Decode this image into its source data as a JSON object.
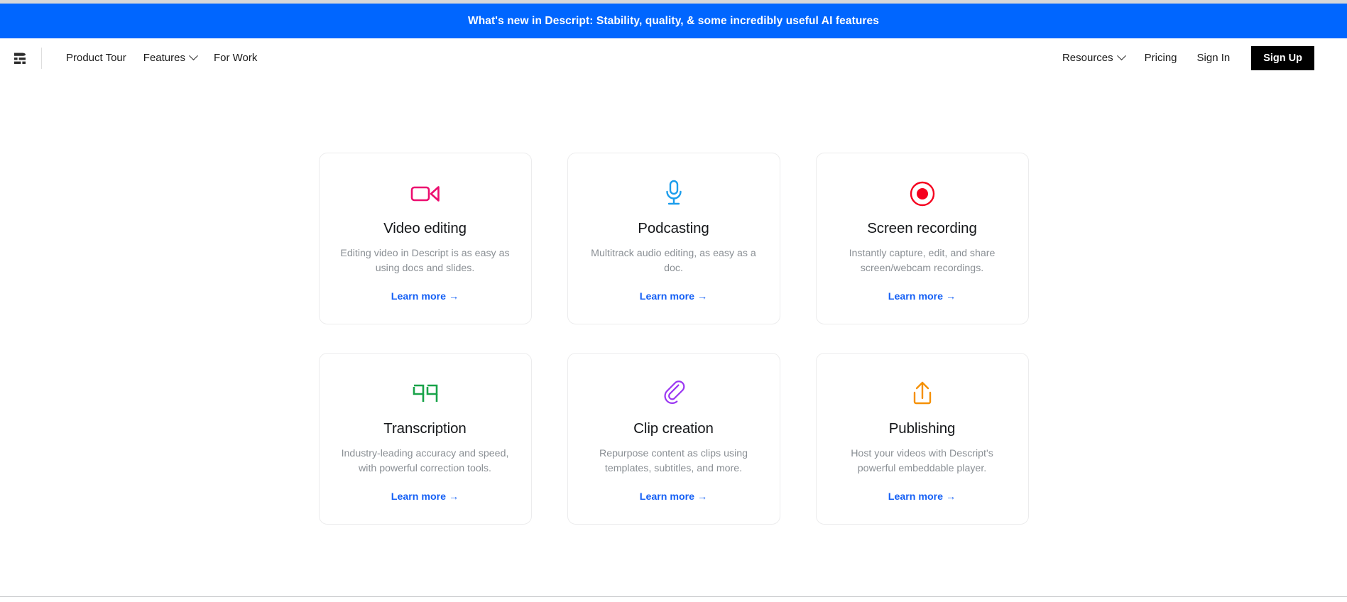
{
  "banner": {
    "text": "What's new in Descript: Stability, quality, & some incredibly useful AI features",
    "background_color": "#0066ff",
    "text_color": "#ffffff"
  },
  "nav": {
    "logo_name": "descript-logo",
    "left_links": [
      {
        "label": "Product Tour",
        "has_chevron": false
      },
      {
        "label": "Features",
        "has_chevron": true
      },
      {
        "label": "For Work",
        "has_chevron": false
      }
    ],
    "right_links": [
      {
        "label": "Resources",
        "has_chevron": true
      },
      {
        "label": "Pricing",
        "has_chevron": false
      },
      {
        "label": "Sign In",
        "has_chevron": false
      }
    ],
    "signup_label": "Sign Up",
    "signup_bg": "#000000"
  },
  "cards": [
    {
      "icon": "video-camera-icon",
      "icon_color": "#ec0d6f",
      "title": "Video editing",
      "description": "Editing video in Descript is as easy as using docs and slides.",
      "link_label": "Learn more →"
    },
    {
      "icon": "microphone-icon",
      "icon_color": "#1b9dec",
      "title": "Podcasting",
      "description": "Multitrack audio editing, as easy as a doc.",
      "link_label": "Learn more →"
    },
    {
      "icon": "record-circle-icon",
      "icon_color": "#f5001e",
      "title": "Screen recording",
      "description": "Instantly capture, edit, and share screen/webcam recordings.",
      "link_label": "Learn more →"
    },
    {
      "icon": "quotation-marks-icon",
      "icon_color": "#18a349",
      "title": "Transcription",
      "description": "Industry-leading accuracy and speed, with powerful correction tools.",
      "link_label": "Learn more →"
    },
    {
      "icon": "paperclip-icon",
      "icon_color": "#9b37f2",
      "title": "Clip creation",
      "description": "Repurpose content as clips using templates, subtitles, and more.",
      "link_label": "Learn more →"
    },
    {
      "icon": "share-upload-icon",
      "icon_color": "#f59000",
      "title": "Publishing",
      "description": "Host your videos with Descript's powerful embeddable player.",
      "link_label": "Learn more →"
    }
  ]
}
